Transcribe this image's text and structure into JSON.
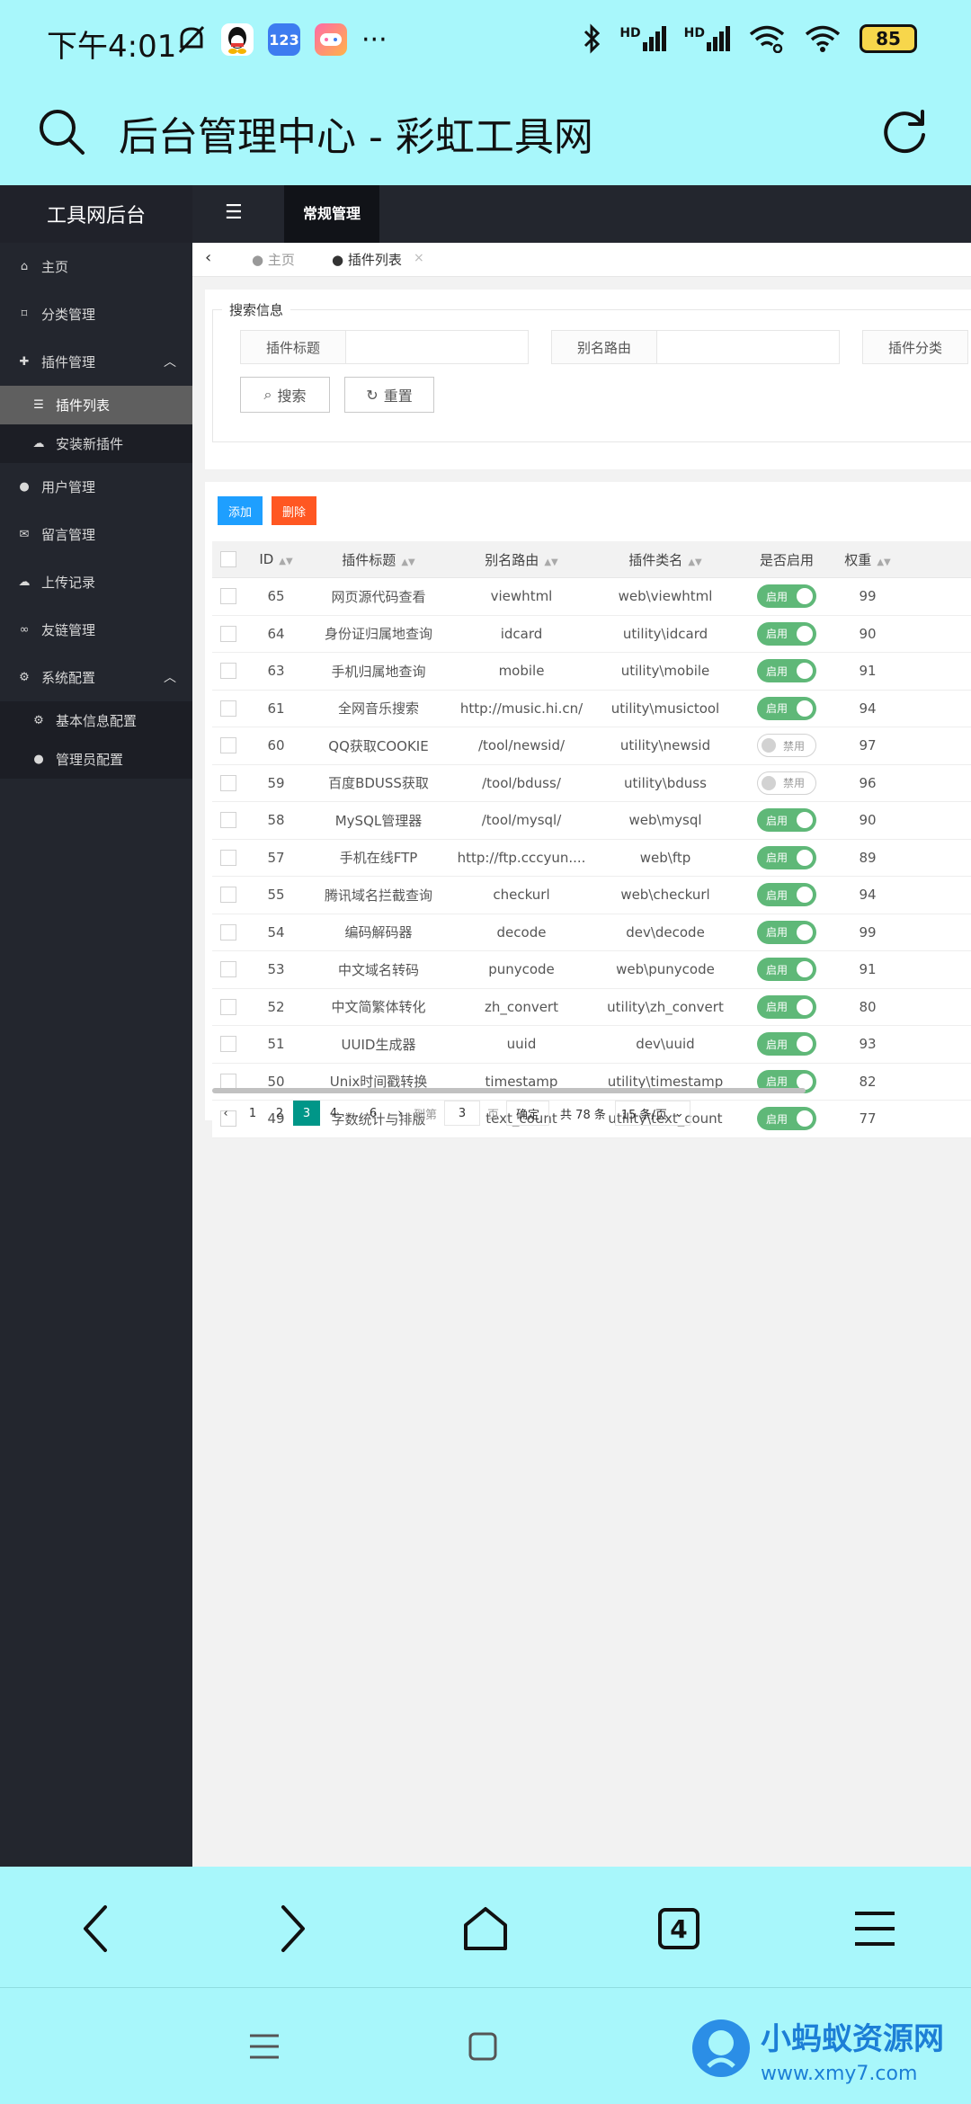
{
  "status_bar": {
    "time": "下午4:01",
    "battery": "85",
    "app_icons": [
      "bell-off-icon",
      "qq-icon",
      "123-app-icon",
      "game-app-icon",
      "more-icon"
    ],
    "right_icons": [
      "bluetooth-icon",
      "hd-signal-icon",
      "hd-signal-icon",
      "wifi-link-icon",
      "wifi-icon"
    ],
    "app123": "123",
    "hd1": "HD",
    "hd2": "HD",
    "more": "···"
  },
  "browser": {
    "page_title": "后台管理中心 - 彩虹工具网",
    "tab_count": "4"
  },
  "app": {
    "logo": "工具网后台",
    "top_tab": "常规管理",
    "nav_toggle_icon": "☰"
  },
  "sidebar": {
    "items": [
      {
        "label": "主页",
        "icon": "home-icon"
      },
      {
        "label": "分类管理",
        "icon": "bookmark-icon"
      },
      {
        "label": "插件管理",
        "icon": "plugin-icon"
      },
      {
        "label": "插件列表",
        "icon": "list-icon"
      },
      {
        "label": "安装新插件",
        "icon": "cloud-upload-icon"
      },
      {
        "label": "用户管理",
        "icon": "user-icon"
      },
      {
        "label": "留言管理",
        "icon": "comment-icon"
      },
      {
        "label": "上传记录",
        "icon": "cloud-icon"
      },
      {
        "label": "友链管理",
        "icon": "link-icon"
      },
      {
        "label": "系统配置",
        "icon": "gears-icon"
      },
      {
        "label": "基本信息配置",
        "icon": "gear-icon"
      },
      {
        "label": "管理员配置",
        "icon": "user-icon"
      }
    ]
  },
  "tabs": {
    "home": "主页",
    "active": "插件列表"
  },
  "search": {
    "legend": "搜索信息",
    "label_title": "插件标题",
    "label_route": "别名路由",
    "label_category": "插件分类",
    "search_btn": "搜索",
    "reset_btn": "重置"
  },
  "actions": {
    "add": "添加",
    "delete": "删除"
  },
  "table": {
    "headers": [
      "ID",
      "插件标题",
      "别名路由",
      "插件类名",
      "是否启用",
      "权重"
    ],
    "rows": [
      {
        "id": "65",
        "title": "网页源代码查看",
        "route": "viewhtml",
        "class": "web\\viewhtml",
        "enabled": true,
        "weight": "99"
      },
      {
        "id": "64",
        "title": "身份证归属地查询",
        "route": "idcard",
        "class": "utility\\idcard",
        "enabled": true,
        "weight": "90"
      },
      {
        "id": "63",
        "title": "手机归属地查询",
        "route": "mobile",
        "class": "utility\\mobile",
        "enabled": true,
        "weight": "91"
      },
      {
        "id": "61",
        "title": "全网音乐搜索",
        "route": "http://music.hi.cn/",
        "class": "utility\\musictool",
        "enabled": true,
        "weight": "94"
      },
      {
        "id": "60",
        "title": "QQ获取COOKIE",
        "route": "/tool/newsid/",
        "class": "utility\\newsid",
        "enabled": false,
        "weight": "97"
      },
      {
        "id": "59",
        "title": "百度BDUSS获取",
        "route": "/tool/bduss/",
        "class": "utility\\bduss",
        "enabled": false,
        "weight": "96"
      },
      {
        "id": "58",
        "title": "MySQL管理器",
        "route": "/tool/mysql/",
        "class": "web\\mysql",
        "enabled": true,
        "weight": "90"
      },
      {
        "id": "57",
        "title": "手机在线FTP",
        "route": "http://ftp.cccyun....",
        "class": "web\\ftp",
        "enabled": true,
        "weight": "89"
      },
      {
        "id": "55",
        "title": "腾讯域名拦截查询",
        "route": "checkurl",
        "class": "web\\checkurl",
        "enabled": true,
        "weight": "94"
      },
      {
        "id": "54",
        "title": "编码解码器",
        "route": "decode",
        "class": "dev\\decode",
        "enabled": true,
        "weight": "99"
      },
      {
        "id": "53",
        "title": "中文域名转码",
        "route": "punycode",
        "class": "web\\punycode",
        "enabled": true,
        "weight": "91"
      },
      {
        "id": "52",
        "title": "中文简繁体转化",
        "route": "zh_convert",
        "class": "utility\\zh_convert",
        "enabled": true,
        "weight": "80"
      },
      {
        "id": "51",
        "title": "UUID生成器",
        "route": "uuid",
        "class": "dev\\uuid",
        "enabled": true,
        "weight": "93"
      },
      {
        "id": "50",
        "title": "Unix时间戳转换",
        "route": "timestamp",
        "class": "utility\\timestamp",
        "enabled": true,
        "weight": "82"
      },
      {
        "id": "49",
        "title": "字数统计与排版",
        "route": "text_count",
        "class": "utility\\text_count",
        "enabled": true,
        "weight": "77"
      }
    ],
    "enabled_label": "启用",
    "disabled_label": "禁用"
  },
  "pager": {
    "pages": [
      "1",
      "2",
      "3",
      "4",
      "...",
      "6"
    ],
    "current": "3",
    "goto_label": "到第",
    "goto_value": "3",
    "page_unit": "页",
    "confirm": "确定",
    "total": "共 78 条",
    "per_page": "15 条/页"
  },
  "watermark": {
    "text": "小蚂蚁资源网",
    "url": "www.xmy7.com"
  },
  "colors": {
    "browser_bg": "#a8f7fb",
    "sidebar_bg": "#23262e",
    "switch_on": "#5fb878",
    "pager_current": "#009688",
    "add_btn": "#1e9fff",
    "delete_btn": "#ff5722"
  }
}
